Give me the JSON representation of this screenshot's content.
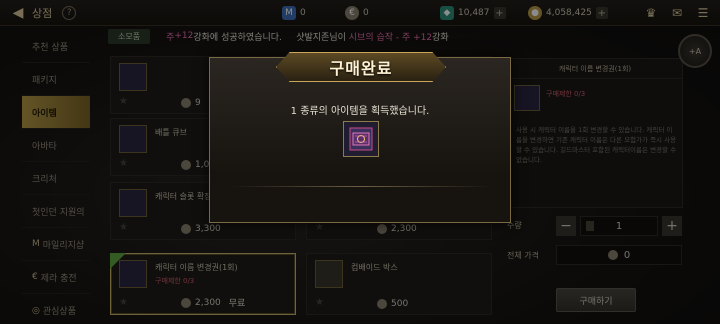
{
  "header": {
    "title": "상점"
  },
  "currencies": [
    {
      "icon": "m-currency-icon",
      "value": "0",
      "color": "#3c6fb8"
    },
    {
      "icon": "coin-currency-icon",
      "value": "0",
      "color": "#8a8270"
    },
    {
      "icon": "crystal-currency-icon",
      "value": "10,487",
      "color": "#2e8f79"
    },
    {
      "icon": "gold-currency-icon",
      "value": "4,058,425",
      "color": "#b79a48"
    }
  ],
  "sidebar": {
    "items": [
      {
        "label": "추천 상품"
      },
      {
        "label": "패키지"
      },
      {
        "label": "아이템"
      },
      {
        "label": "아바타"
      },
      {
        "label": "크리처"
      },
      {
        "label": "첫인던 지원의"
      },
      {
        "label": "마일리지샵"
      },
      {
        "label": "제라 충전"
      },
      {
        "label": "관심상품"
      }
    ],
    "active_index": 2
  },
  "ticker": {
    "tab": "소모품",
    "segments": [
      {
        "text": "주 ",
        "style": "pink"
      },
      {
        "text": "+12",
        "style": "pink"
      },
      {
        "text": " 강화에 성공하였습니다.",
        "style": "white"
      },
      {
        "text": "     샷발지존님이 ",
        "style": "white"
      },
      {
        "text": "시브의 습작 - 주 +12",
        "style": "pink"
      },
      {
        "text": " 강화",
        "style": "white"
      }
    ]
  },
  "products": [
    {
      "name": "",
      "sub": "",
      "price": "9"
    },
    {
      "name": "",
      "sub": "",
      "price": ""
    },
    {
      "name": "배틀 큐브",
      "sub": "",
      "price": "1,0"
    },
    {
      "name": "",
      "sub": "",
      "price": ""
    },
    {
      "name": "캐릭터 슬롯 확장",
      "sub": "",
      "price": "3,300"
    },
    {
      "name": "",
      "sub": "",
      "price": "2,300"
    },
    {
      "name": "캐릭터 이름 변경권(1회)",
      "sub": "구매제한 0/3",
      "price": "2,300",
      "extra": "무료"
    },
    {
      "name": "컴배이드 박스",
      "sub": "",
      "price": "500"
    }
  ],
  "detail": {
    "title": "캐릭터 이름 변경권(1회)",
    "sub": "구매제한 0/3",
    "description": "사용 시 캐릭터 이름을 1회 변경할 수 있습니다. 캐릭터 이름을 변경하면 기존 캐릭터 이름은 다른 모험가가 즉시 사용할 수 있습니다. 길드마스터 포함된 캐릭터이름은 변경할 수 없습니다."
  },
  "purchase": {
    "quantity_label": "수량",
    "quantity": "1",
    "minus": "−",
    "plus": "+",
    "total_label": "전체 가격",
    "total": "0",
    "buy_label": "구매하기"
  },
  "modal": {
    "title": "구매완료",
    "message": "1 종류의 아이템을 획득했습니다."
  },
  "profile_badge": "+A"
}
